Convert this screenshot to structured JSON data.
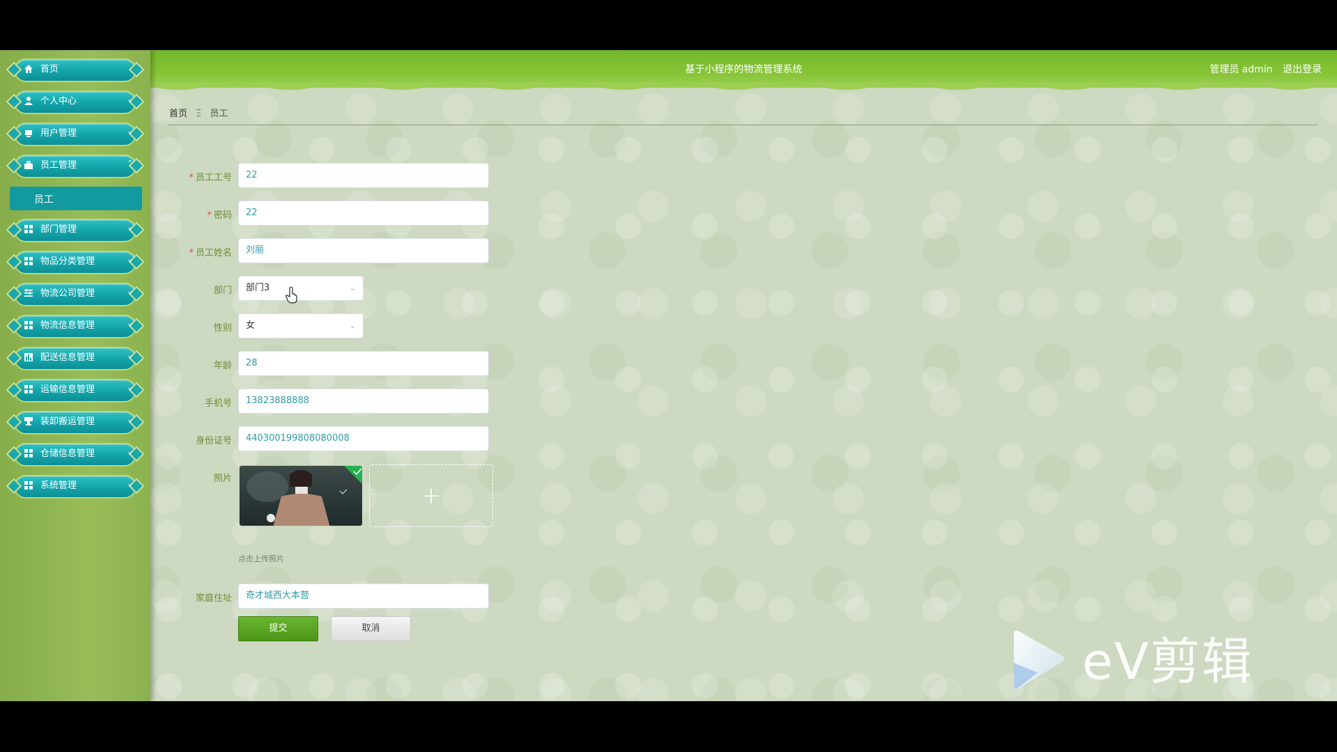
{
  "header": {
    "title": "基于小程序的物流管理系统",
    "user_label": "管理员 admin",
    "logout": "退出登录"
  },
  "sidebar": {
    "items": [
      {
        "label": "首页",
        "icon": "home-icon",
        "expanded": null
      },
      {
        "label": "个人中心",
        "icon": "user-icon",
        "expanded": false
      },
      {
        "label": "用户管理",
        "icon": "card-icon",
        "expanded": false
      },
      {
        "label": "员工管理",
        "icon": "briefcase-icon",
        "expanded": true
      },
      {
        "label": "部门管理",
        "icon": "grid-icon",
        "expanded": false
      },
      {
        "label": "物品分类管理",
        "icon": "grid-icon",
        "expanded": false
      },
      {
        "label": "物流公司管理",
        "icon": "sliders-icon",
        "expanded": false
      },
      {
        "label": "物流信息管理",
        "icon": "grid-icon",
        "expanded": false
      },
      {
        "label": "配送信息管理",
        "icon": "chart-icon",
        "expanded": false
      },
      {
        "label": "运输信息管理",
        "icon": "grid-icon",
        "expanded": false
      },
      {
        "label": "装卸搬运管理",
        "icon": "cup-icon",
        "expanded": false
      },
      {
        "label": "仓储信息管理",
        "icon": "grid-icon",
        "expanded": false
      },
      {
        "label": "系统管理",
        "icon": "grid-icon",
        "expanded": false
      }
    ],
    "sub_item": "员工"
  },
  "breadcrumb": {
    "home": "首页",
    "sep": "Ξ",
    "current": "员工"
  },
  "form": {
    "employee_no": {
      "label": "员工工号",
      "value": "22",
      "required": true
    },
    "password": {
      "label": "密码",
      "value": "22",
      "required": true
    },
    "name": {
      "label": "员工姓名",
      "value": "刘丽",
      "required": true
    },
    "department": {
      "label": "部门",
      "value": "部门3"
    },
    "gender": {
      "label": "性别",
      "value": "女"
    },
    "age": {
      "label": "年龄",
      "value": "28"
    },
    "phone": {
      "label": "手机号",
      "value": "13823888888"
    },
    "id_card": {
      "label": "身份证号",
      "value": "440300199808080008"
    },
    "photo": {
      "label": "照片",
      "tip": "点击上传照片"
    },
    "address": {
      "label": "家庭住址",
      "value": "奇才城西大本营"
    },
    "submit": "提交",
    "cancel": "取消",
    "required_mark": "*"
  },
  "watermark": {
    "text": "eV剪辑"
  },
  "colors": {
    "accent": "#12a3aa",
    "header": "#86c436",
    "sidebar": "#98bd59",
    "label": "#6c8b35",
    "value": "#2e9aa6"
  }
}
